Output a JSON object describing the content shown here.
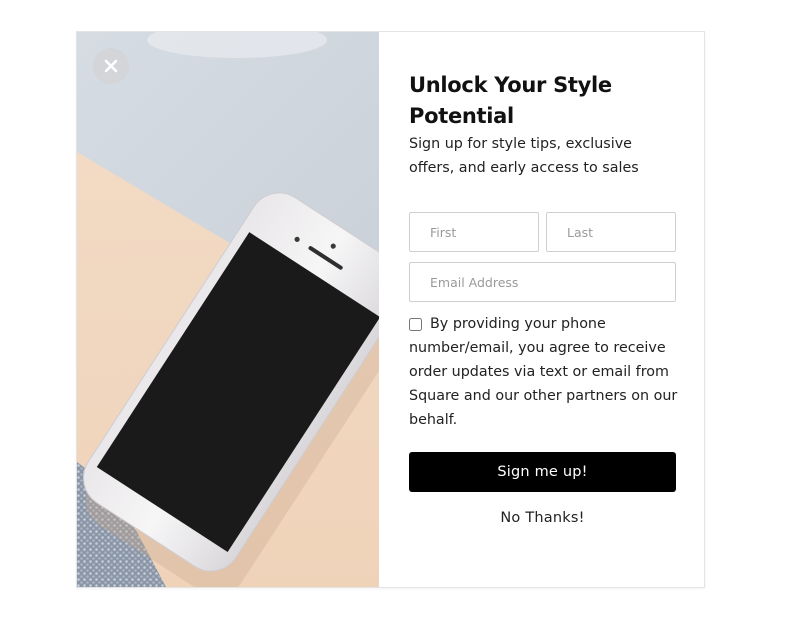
{
  "popup": {
    "title": "Unlock Your Style Potential",
    "subtitle": "Sign up for style tips, exclusive offers, and early access to sales",
    "close_icon": "close-icon",
    "image": "phone-on-desk-photo",
    "form": {
      "first_name_placeholder": "First",
      "last_name_placeholder": "Last",
      "email_placeholder": "Email Address",
      "first_name_value": "",
      "last_name_value": "",
      "email_value": "",
      "consent_checked": false,
      "consent_text": "By providing your phone number/email, you agree to receive order updates via text or email from Square and our other partners on our behalf.",
      "submit_label": "Sign me up!",
      "decline_label": "No Thanks!"
    }
  },
  "colors": {
    "button_bg": "#000000",
    "button_text": "#ffffff",
    "text": "#222222",
    "input_border": "#cfcfcf"
  }
}
